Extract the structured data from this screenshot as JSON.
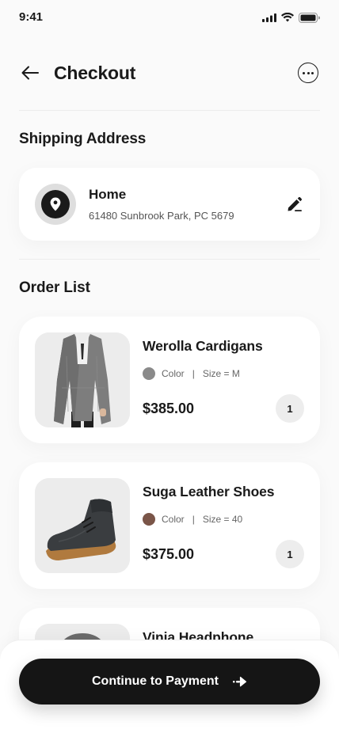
{
  "status_bar": {
    "time": "9:41"
  },
  "header": {
    "title": "Checkout"
  },
  "shipping": {
    "section_title": "Shipping Address",
    "label": "Home",
    "address": "61480 Sunbrook Park, PC 5679"
  },
  "orders": {
    "section_title": "Order List",
    "items": [
      {
        "name": "Werolla Cardigans",
        "color_label": "Color",
        "color": "#8a8a8a",
        "size": "Size = M",
        "price": "$385.00",
        "qty": "1"
      },
      {
        "name": "Suga Leather Shoes",
        "color_label": "Color",
        "color": "#7a5548",
        "size": "Size = 40",
        "price": "$375.00",
        "qty": "1"
      },
      {
        "name": "Vinia Headphone"
      }
    ]
  },
  "meta_separator": "|",
  "cta": {
    "label": "Continue to Payment",
    "icon": "arrow-right-icon"
  }
}
